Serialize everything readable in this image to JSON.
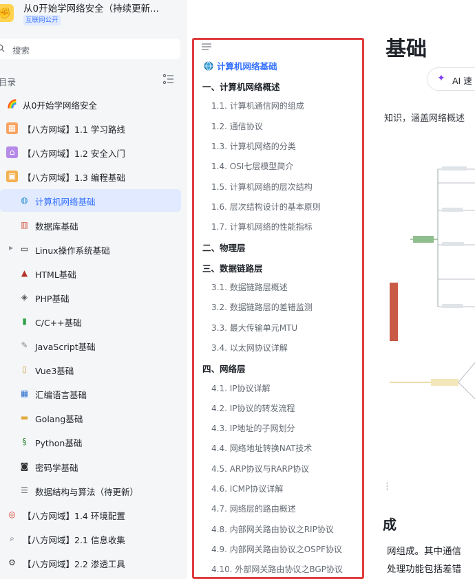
{
  "knowledge_base": {
    "avatar_emoji": "✊",
    "title": "从0开始学网络安全（持续更新...",
    "badge": "互联网公开"
  },
  "search": {
    "placeholder": "搜索"
  },
  "toc_heading": "目录",
  "nav_items": [
    {
      "label": "从0开始学网络安全",
      "icon": "rainbow-icon",
      "level": 1
    },
    {
      "label": "【八方网域】1.1 学习路线",
      "icon": "chart-icon",
      "level": 1
    },
    {
      "label": "【八方网域】1.2 安全入门",
      "icon": "home-icon",
      "level": 1
    },
    {
      "label": "【八方网域】1.3 编程基础",
      "icon": "box-icon",
      "level": 1
    },
    {
      "label": "计算机网络基础",
      "icon": "globe-icon",
      "level": 2,
      "active": true
    },
    {
      "label": "数据库基础",
      "icon": "bar-chart-icon",
      "level": 2
    },
    {
      "label": "Linux操作系统基础",
      "icon": "laptop-icon",
      "level": 2,
      "expandable": true
    },
    {
      "label": "HTML基础",
      "icon": "hat-icon",
      "level": 2
    },
    {
      "label": "PHP基础",
      "icon": "php-icon",
      "level": 2
    },
    {
      "label": "C/C++基础",
      "icon": "c-book-icon",
      "level": 2
    },
    {
      "label": "JavaScript基础",
      "icon": "note-icon",
      "level": 2
    },
    {
      "label": "Vue3基础",
      "icon": "page-icon",
      "level": 2
    },
    {
      "label": "汇编语言基础",
      "icon": "grid-icon",
      "level": 2
    },
    {
      "label": "Golang基础",
      "icon": "folder-icon",
      "level": 2
    },
    {
      "label": "Python基础",
      "icon": "snake-icon",
      "level": 2
    },
    {
      "label": "密码学基础",
      "icon": "lock-icon",
      "level": 2
    },
    {
      "label": "数据结构与算法（待更新）",
      "icon": "doc-icon",
      "level": 2
    },
    {
      "label": "【八方网域】1.4 环境配置",
      "icon": "target-icon",
      "level": 1
    },
    {
      "label": "【八方网域】2.1 信息收集",
      "icon": "magnifier-icon",
      "level": 1
    },
    {
      "label": "【八方网域】2.2 渗透工具",
      "icon": "gear-icon",
      "level": 1
    }
  ],
  "document": {
    "title": "基础",
    "ai_button": "AI 速",
    "intro": "知识，涵盖网络概述",
    "section_heading": "成",
    "body_line_1": "网组成。其中通信",
    "body_line_2": "处理功能包括差错"
  },
  "outline": {
    "title": "计算机网络基础",
    "items": [
      {
        "text": "一、计算机网络概述",
        "level": 1
      },
      {
        "text": "1.1. 计算机通信网的组成",
        "level": 2
      },
      {
        "text": "1.2. 通信协议",
        "level": 2
      },
      {
        "text": "1.3. 计算机网络的分类",
        "level": 2
      },
      {
        "text": "1.4. OSI七层模型简介",
        "level": 2
      },
      {
        "text": "1.5. 计算机网络的层次结构",
        "level": 2
      },
      {
        "text": "1.6. 层次结构设计的基本原则",
        "level": 2
      },
      {
        "text": "1.7. 计算机网络的性能指标",
        "level": 2
      },
      {
        "text": "二、物理层",
        "level": 1
      },
      {
        "text": "三、数据链路层",
        "level": 1
      },
      {
        "text": "3.1. 数据链路层概述",
        "level": 2
      },
      {
        "text": "3.2. 数据链路层的差错监测",
        "level": 2
      },
      {
        "text": "3.3. 最大传输单元MTU",
        "level": 2
      },
      {
        "text": "3.4. 以太网协议详解",
        "level": 2
      },
      {
        "text": "四、网络层",
        "level": 1
      },
      {
        "text": "4.1. IP协议详解",
        "level": 2
      },
      {
        "text": "4.2. IP协议的转发流程",
        "level": 2
      },
      {
        "text": "4.3. IP地址的子网划分",
        "level": 2
      },
      {
        "text": "4.4. 网络地址转换NAT技术",
        "level": 2
      },
      {
        "text": "4.5. ARP协议与RARP协议",
        "level": 2
      },
      {
        "text": "4.6. ICMP协议详解",
        "level": 2
      },
      {
        "text": "4.7. 网络层的路由概述",
        "level": 2
      },
      {
        "text": "4.8. 内部网关路由协议之RIP协议",
        "level": 2
      },
      {
        "text": "4.9. 内部网关路由协议之OSPF协议",
        "level": 2
      },
      {
        "text": "4.10. 外部网关路由协议之BGP协议",
        "level": 2
      }
    ]
  },
  "colors": {
    "accent": "#3370ff",
    "active_bg": "#e1eaff",
    "highlight_border": "#df3b3b",
    "sidebar_bg": "#f5f6f7"
  }
}
